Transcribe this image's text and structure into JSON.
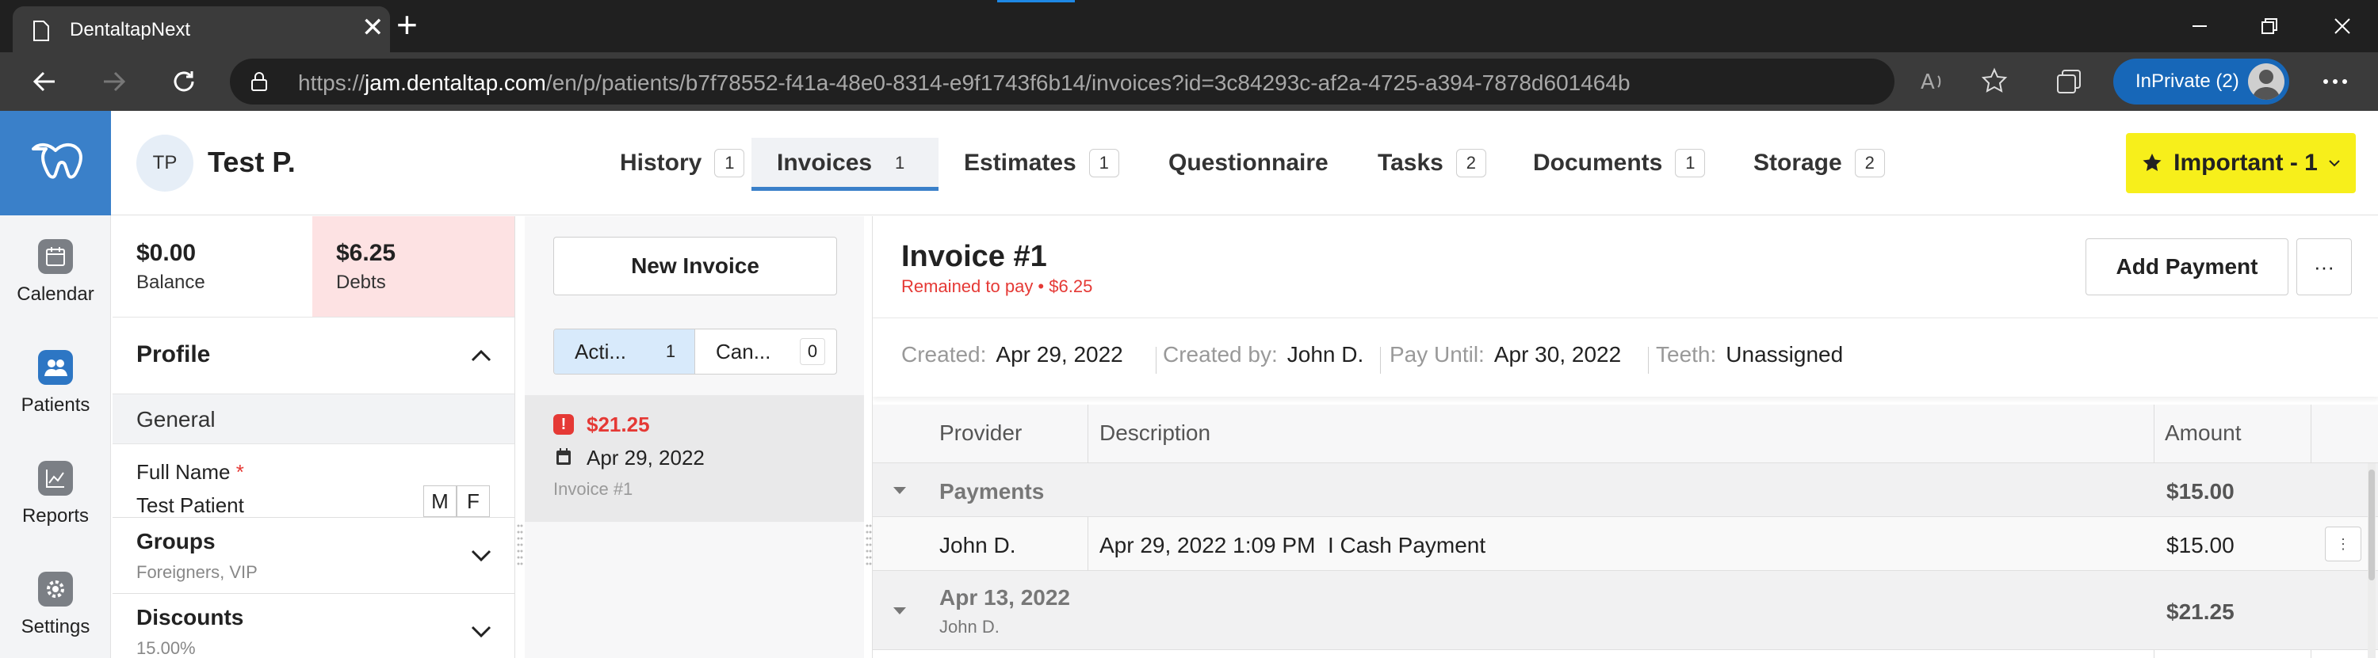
{
  "browser": {
    "tab_title": "DentaltapNext",
    "url_prefix": "https://",
    "url_domain": "jam.dentaltap.com",
    "url_path": "/en/p/patients/b7f78552-f41a-48e0-8314-e9f1743f6b14/invoices?id=3c84293c-af2a-4725-a394-7878d601464b",
    "inprivate_label": "InPrivate (2)",
    "accent_color": "#1767b8"
  },
  "nav": {
    "items": [
      {
        "label": "Calendar",
        "icon": "calendar-icon"
      },
      {
        "label": "Patients",
        "icon": "patients-icon"
      },
      {
        "label": "Reports",
        "icon": "reports-icon"
      },
      {
        "label": "Settings",
        "icon": "settings-icon"
      }
    ],
    "brand_color": "#3a80c9"
  },
  "patient": {
    "initials": "TP",
    "name": "Test P."
  },
  "tabs": [
    {
      "label": "History",
      "count": "1"
    },
    {
      "label": "Invoices",
      "count": "1"
    },
    {
      "label": "Estimates",
      "count": "1"
    },
    {
      "label": "Questionnaire",
      "count": ""
    },
    {
      "label": "Tasks",
      "count": "2"
    },
    {
      "label": "Documents",
      "count": "1"
    },
    {
      "label": "Storage",
      "count": "2"
    }
  ],
  "important_button": "Important - 1",
  "profile": {
    "balance_value": "$0.00",
    "balance_label": "Balance",
    "debts_value": "$6.25",
    "debts_label": "Debts",
    "section_title": "Profile",
    "general_label": "General",
    "full_name_label": "Full Name",
    "required_mark": "*",
    "full_name_value": "Test Patient",
    "gender_m": "M",
    "gender_f": "F",
    "groups_title": "Groups",
    "groups_value": "Foreigners, VIP",
    "discounts_title": "Discounts",
    "discounts_value": "15.00%"
  },
  "invoice_list": {
    "new_invoice_label": "New Invoice",
    "filter_active_label": "Acti...",
    "filter_active_count": "1",
    "filter_cancelled_label": "Can...",
    "filter_cancelled_count": "0",
    "card": {
      "amount": "$21.25",
      "date": "Apr 29, 2022",
      "number": "Invoice #1"
    }
  },
  "invoice": {
    "title": "Invoice #1",
    "remained": "Remained to pay • $6.25",
    "add_payment_label": "Add Payment",
    "more_label": "···",
    "created_key": "Created:",
    "created_val": "Apr 29, 2022",
    "created_by_key": "Created by:",
    "created_by_val": "John D.",
    "pay_until_key": "Pay Until:",
    "pay_until_val": "Apr 30, 2022",
    "teeth_key": "Teeth:",
    "teeth_val": "Unassigned",
    "columns": {
      "provider": "Provider",
      "description": "Description",
      "amount": "Amount"
    },
    "payments_group": {
      "title": "Payments",
      "amount": "$15.00"
    },
    "payment_row": {
      "provider": "John D.",
      "description": "Apr 29, 2022 1:09 PM  I Cash Payment",
      "amount": "$15.00"
    },
    "services_group": {
      "title": "Apr 13, 2022",
      "subtitle": "John D.",
      "amount": "$21.25"
    }
  }
}
